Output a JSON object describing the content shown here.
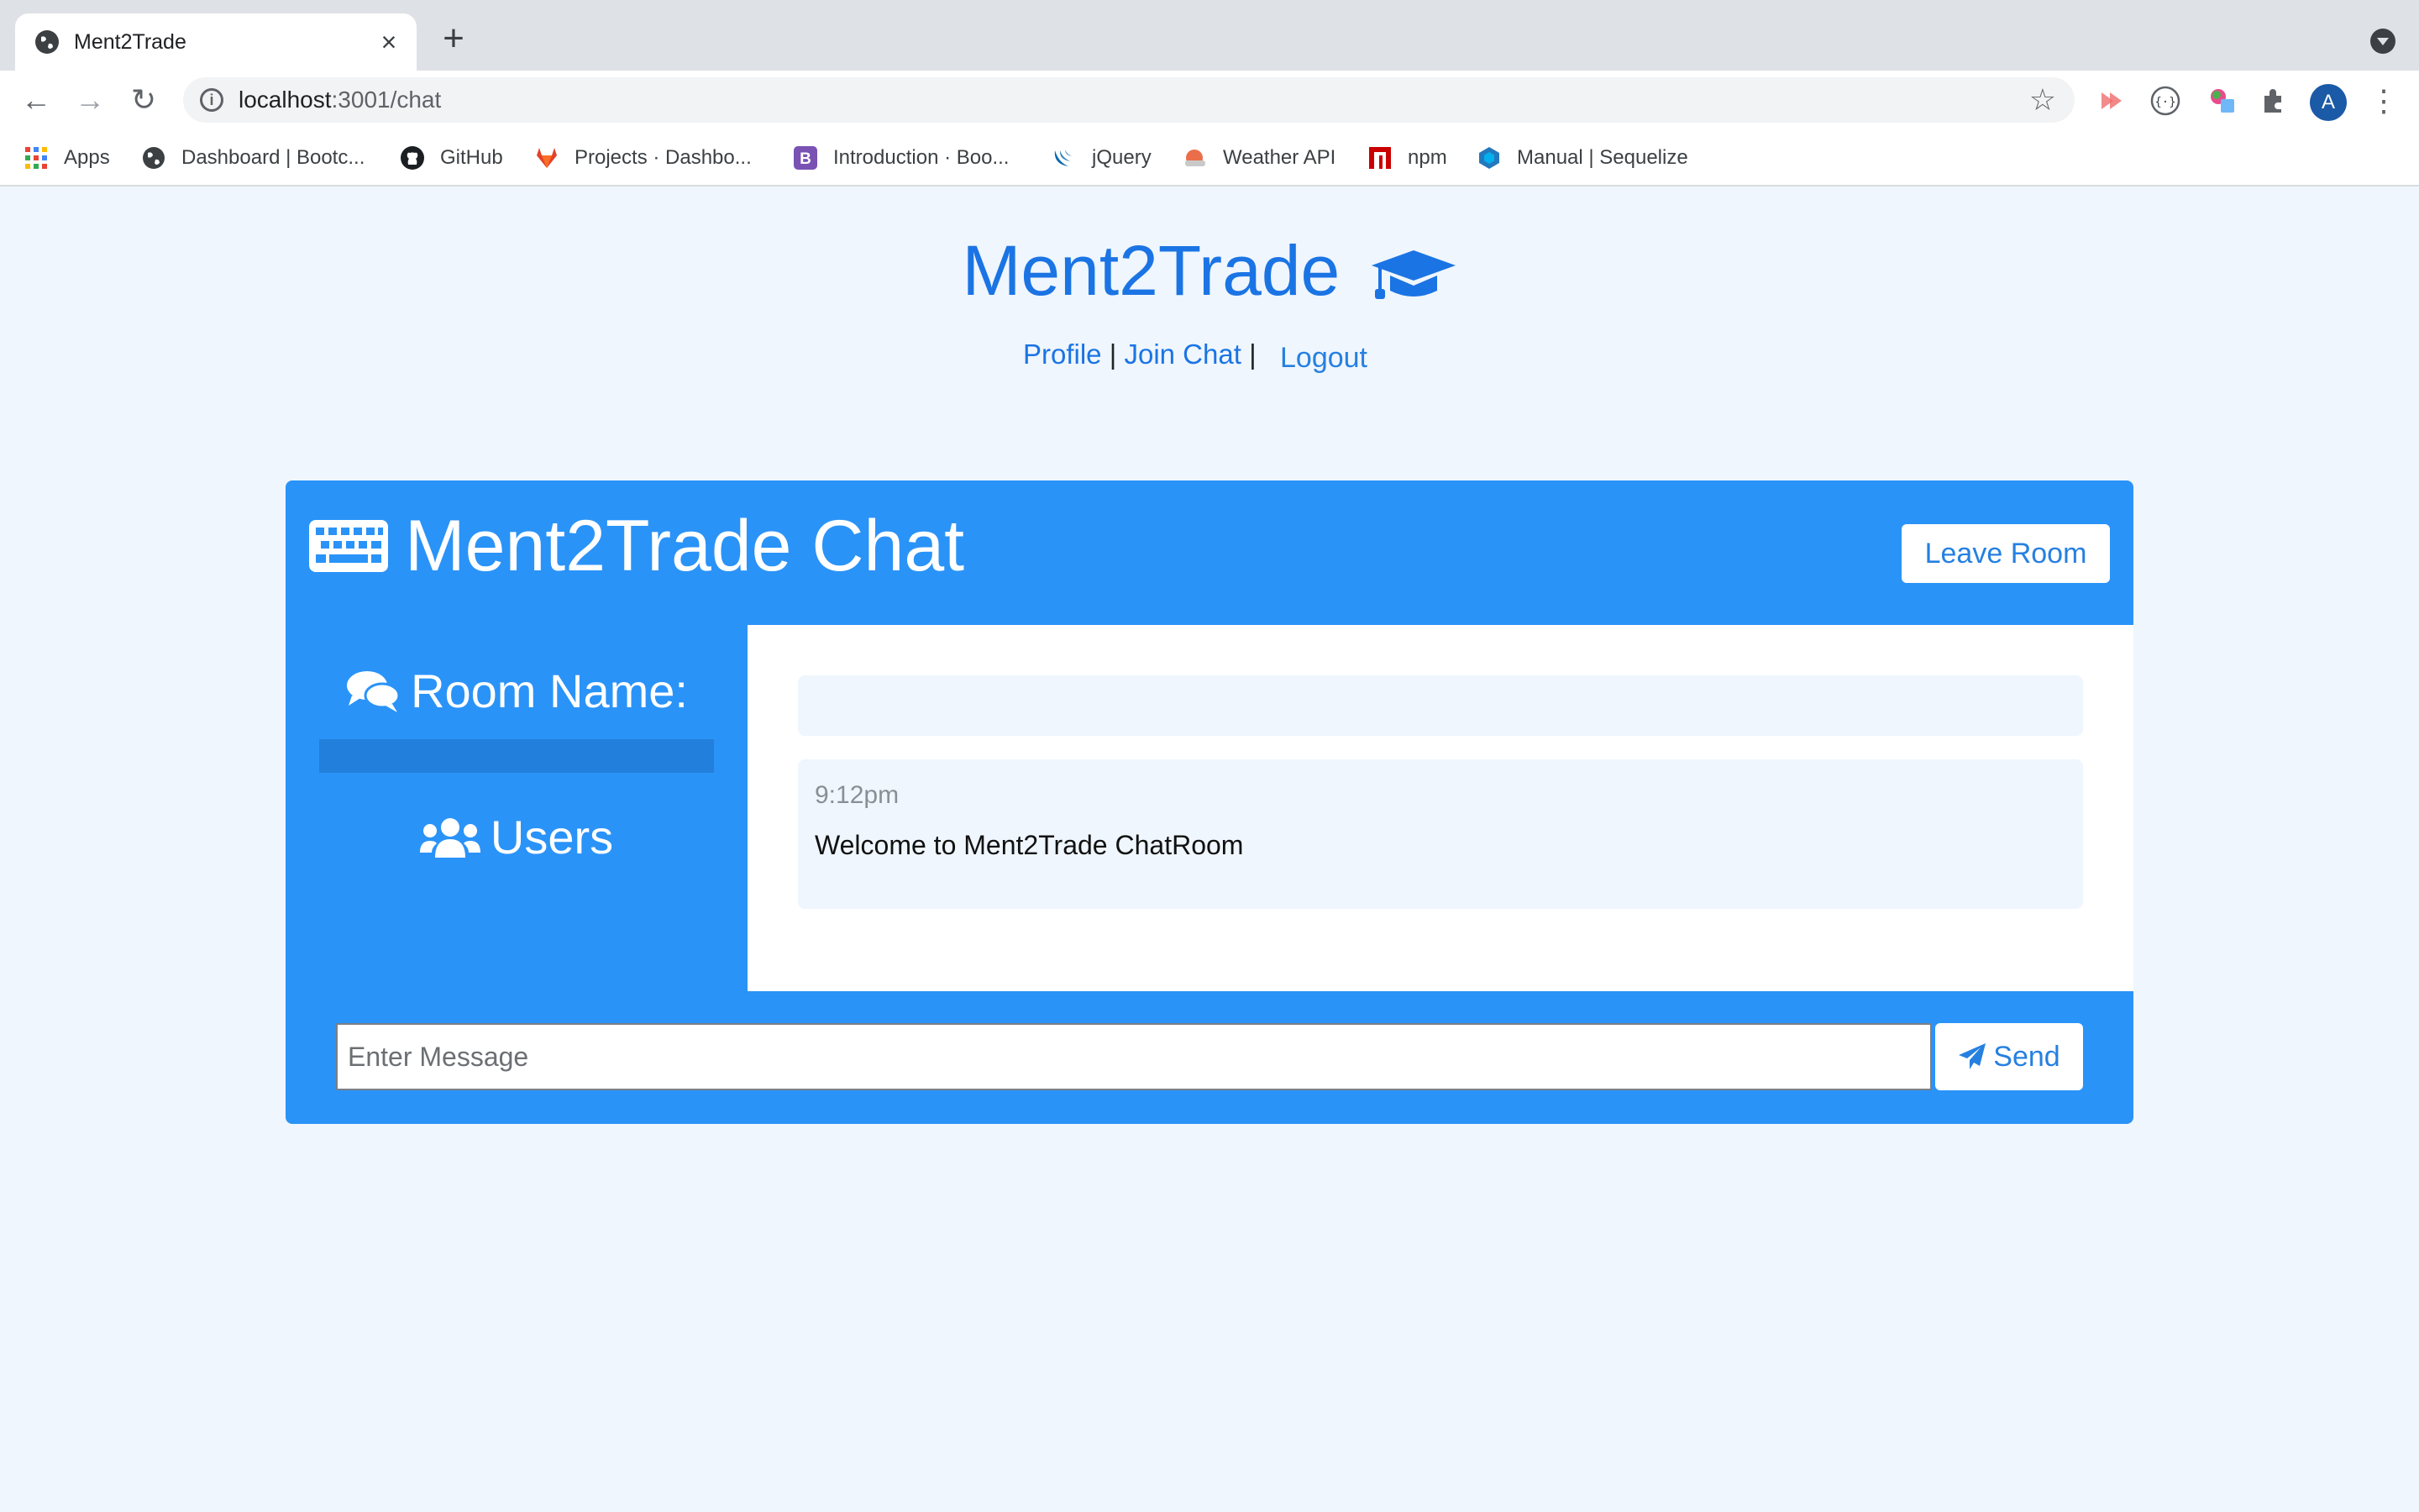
{
  "browser": {
    "tab_title": "Ment2Trade",
    "url_host": "localhost",
    "url_path": ":3001/chat",
    "avatar_letter": "A",
    "bookmarks": [
      {
        "label": "Apps",
        "icon": "apps-grid-icon"
      },
      {
        "label": "Dashboard | Bootc...",
        "icon": "globe-icon"
      },
      {
        "label": "GitHub",
        "icon": "github-icon"
      },
      {
        "label": "Projects · Dashbo...",
        "icon": "gitlab-icon"
      },
      {
        "label": "Introduction · Boo...",
        "icon": "bootstrap-icon"
      },
      {
        "label": "jQuery",
        "icon": "jquery-icon"
      },
      {
        "label": "Weather API",
        "icon": "weather-icon"
      },
      {
        "label": "npm",
        "icon": "npm-icon"
      },
      {
        "label": "Manual | Sequelize",
        "icon": "sequelize-icon"
      }
    ]
  },
  "site": {
    "brand": "Ment2Trade",
    "nav": {
      "profile": "Profile",
      "sep1": "|",
      "join_chat": "Join Chat",
      "sep2": "|",
      "logout": "Logout"
    }
  },
  "chat": {
    "title": "Ment2Trade Chat",
    "leave_button": "Leave Room",
    "room_label": "Room Name:",
    "users_label": "Users",
    "messages": [
      {
        "time": "9:12pm",
        "text": "Welcome to Ment2Trade ChatRoom"
      }
    ],
    "input_placeholder": "Enter Message",
    "send_button": "Send"
  },
  "colors": {
    "brand_blue": "#1b74e4",
    "card_blue": "#2a93f8",
    "page_bg": "#eff6fd"
  }
}
